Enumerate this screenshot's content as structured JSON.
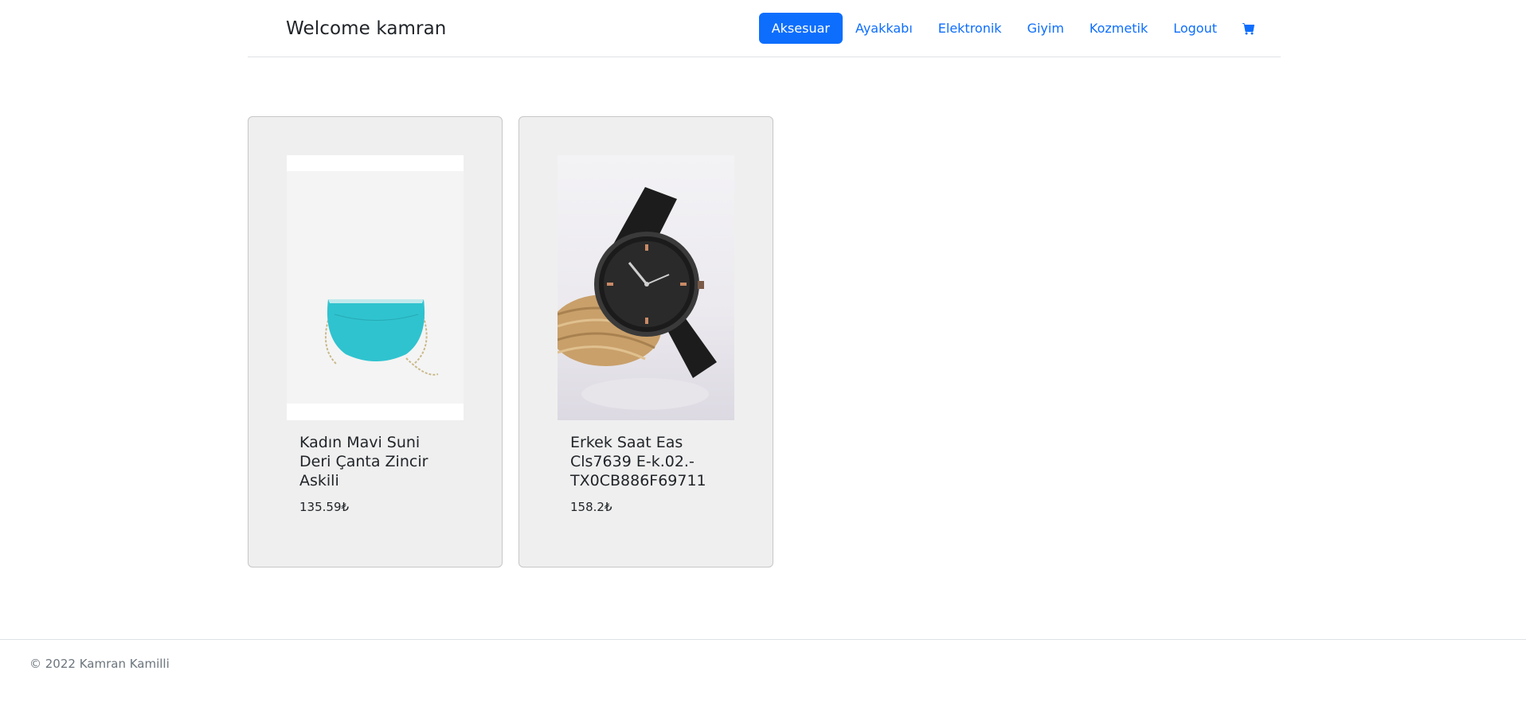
{
  "header": {
    "brand": "Welcome kamran",
    "nav": [
      {
        "label": "Aksesuar",
        "active": true
      },
      {
        "label": "Ayakkabı",
        "active": false
      },
      {
        "label": "Elektronik",
        "active": false
      },
      {
        "label": "Giyim",
        "active": false
      },
      {
        "label": "Kozmetik",
        "active": false
      },
      {
        "label": "Logout",
        "active": false
      }
    ],
    "cart_icon": "cart-icon"
  },
  "products": [
    {
      "title": "Kadın Mavi Suni Deri Çanta Zincir Askili",
      "price": "135.59₺",
      "image": "turquoise-chain-bag"
    },
    {
      "title": "Erkek Saat Eas Cls7639 E-k.02.-TX0CB886F69711",
      "price": "158.2₺",
      "image": "black-leather-watch"
    }
  ],
  "footer": {
    "copyright": "© 2022 Kamran Kamilli"
  },
  "colors": {
    "primary": "#0d6efd",
    "card_bg": "#efefef",
    "muted": "#6c757d"
  }
}
